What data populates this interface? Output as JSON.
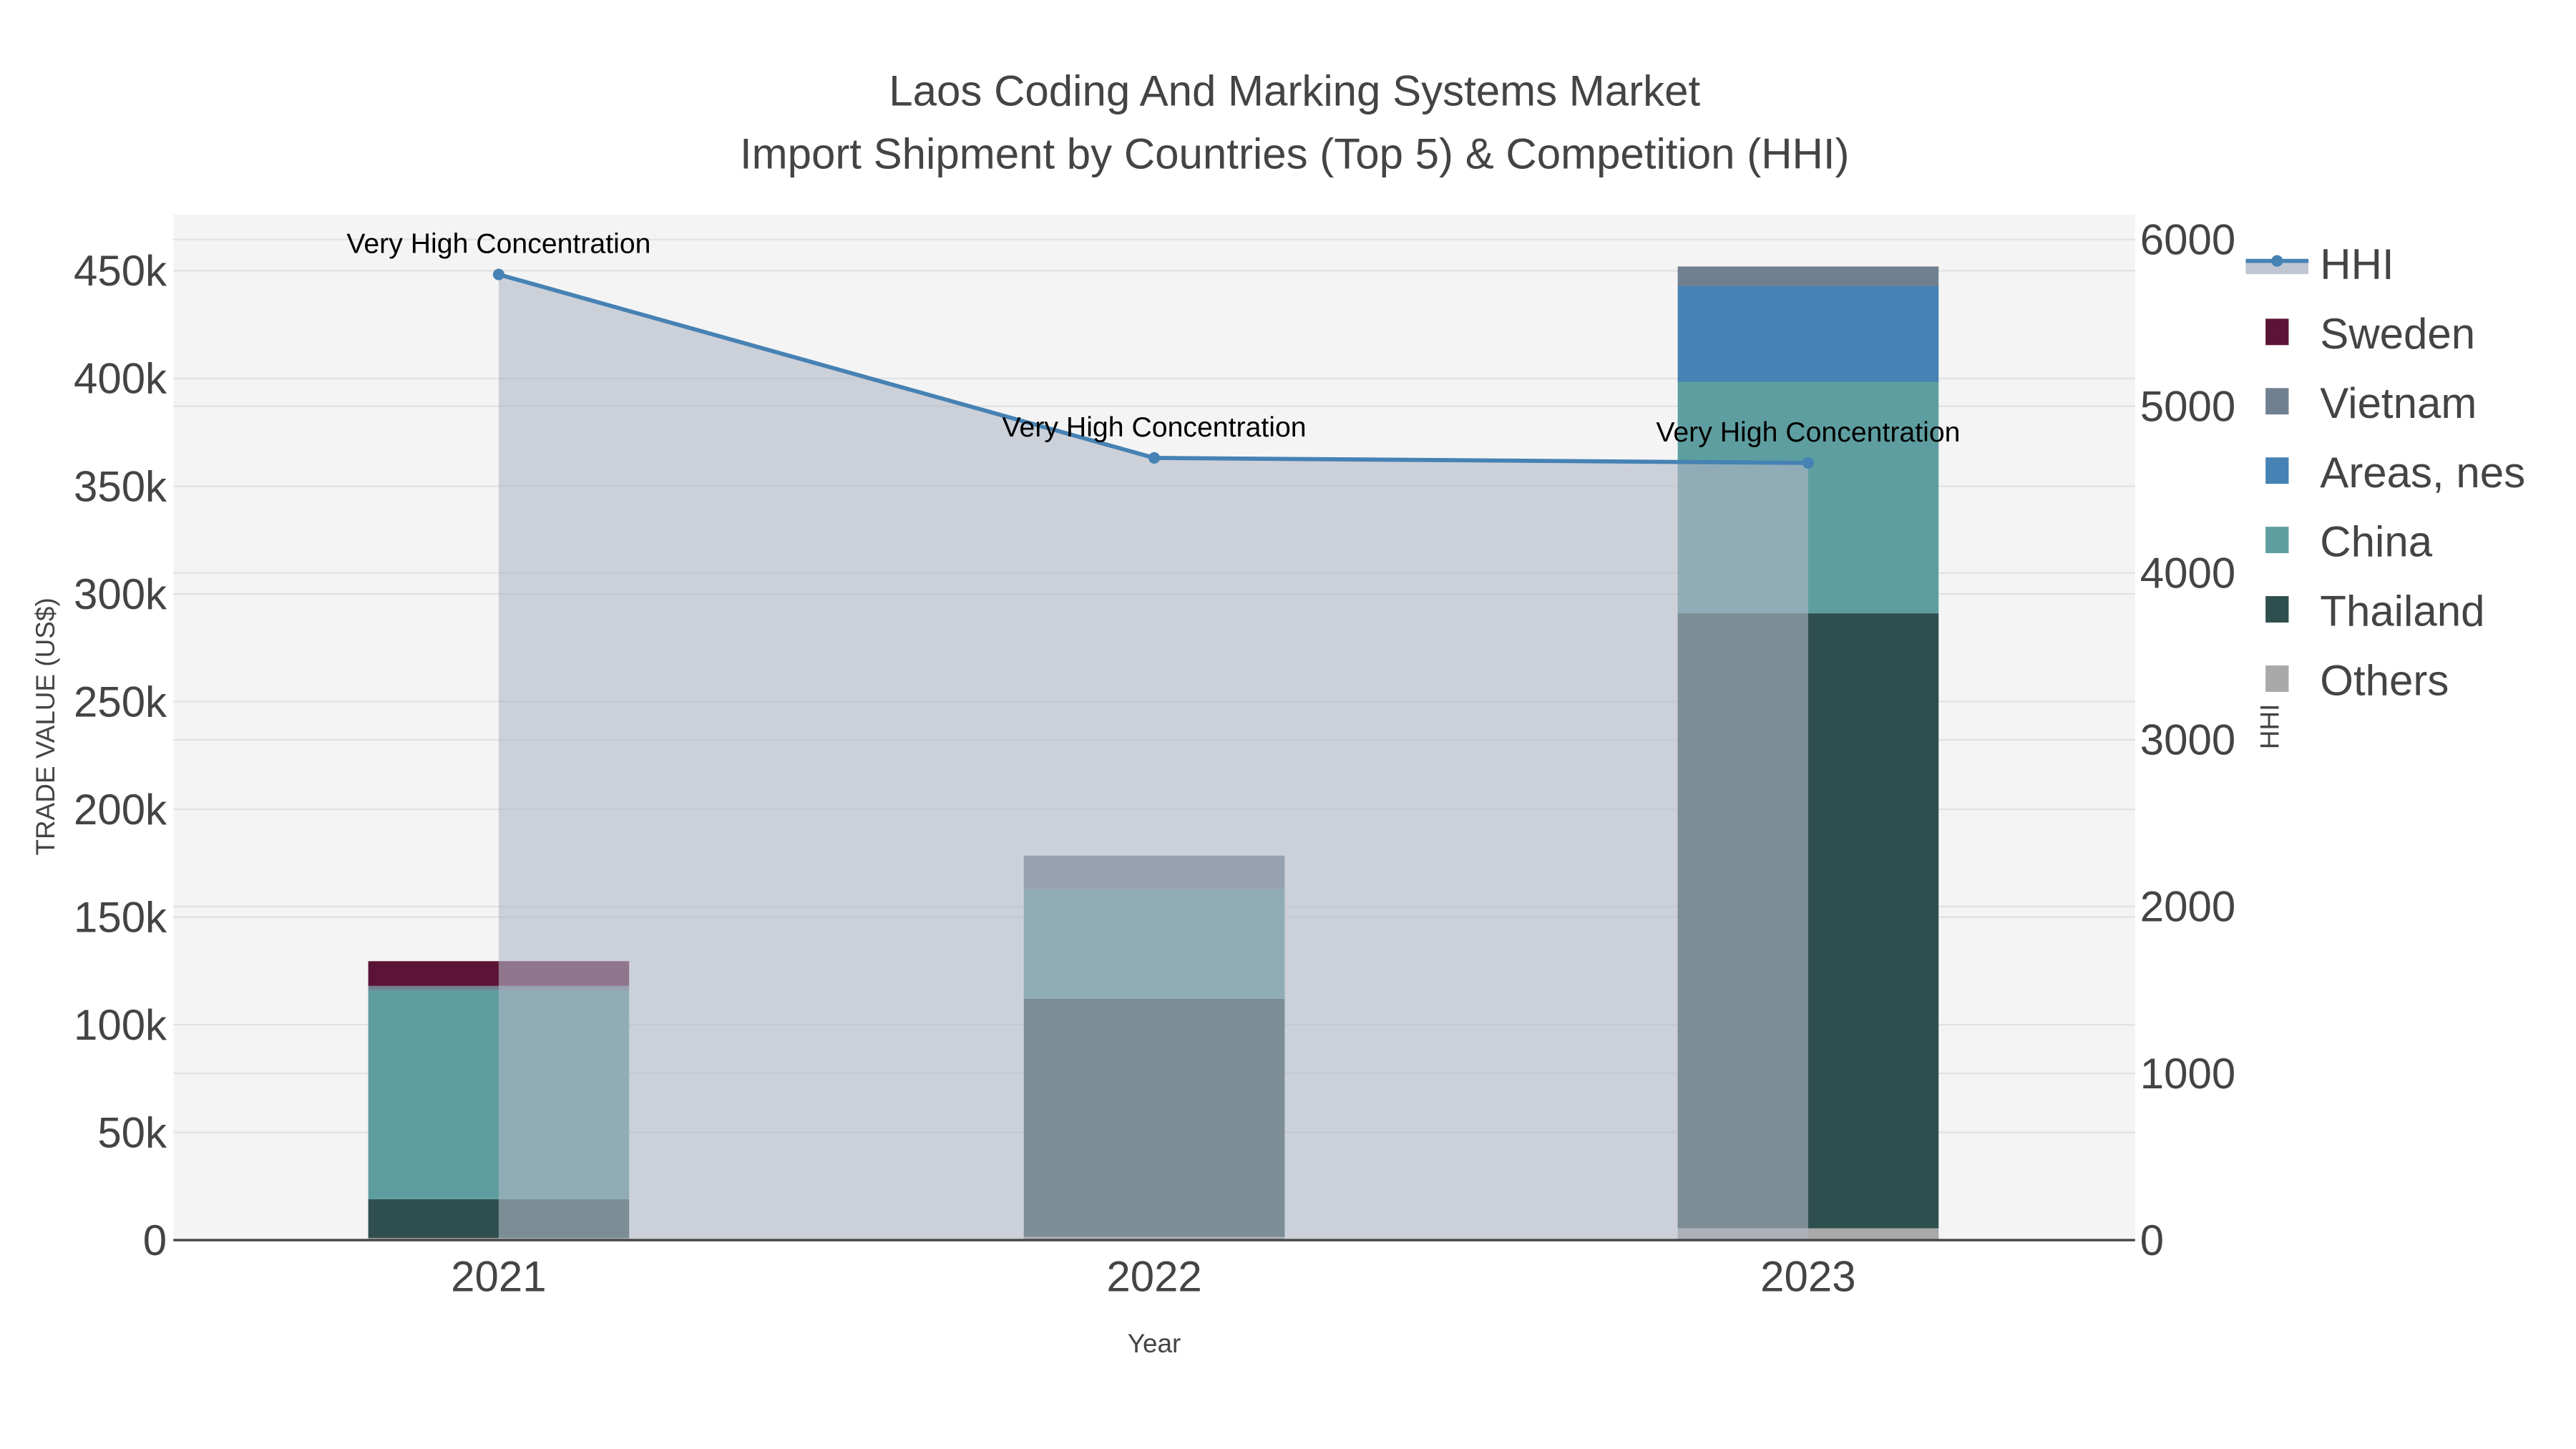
{
  "chart_data": {
    "type": "bar",
    "title": "Laos Coding And Marking Systems Market",
    "subtitle": "Import Shipment by Countries (Top 5) & Competition (HHI)",
    "xlabel": "Year",
    "ylabel": "TRADE VALUE (US$)",
    "y2label": "HHI",
    "categories": [
      "2021",
      "2022",
      "2023"
    ],
    "ylim": [
      0,
      475000
    ],
    "y2lim": [
      0,
      6200
    ],
    "yticks": [
      0,
      50000,
      100000,
      150000,
      200000,
      250000,
      300000,
      350000,
      400000,
      450000
    ],
    "ytick_labels": [
      "0",
      "50k",
      "100k",
      "150k",
      "200k",
      "250k",
      "300k",
      "350k",
      "400k",
      "450k"
    ],
    "y2ticks": [
      0,
      1000,
      2000,
      3000,
      4000,
      5000,
      6000
    ],
    "y2tick_labels": [
      "0",
      "1000",
      "2000",
      "3000",
      "4000",
      "5000",
      "6000"
    ],
    "stack_order": [
      "Others",
      "Thailand",
      "China",
      "Areas, nes",
      "Vietnam",
      "Sweden"
    ],
    "series": [
      {
        "name": "Sweden",
        "color": "#5c1436",
        "values": [
          11500,
          0,
          0
        ]
      },
      {
        "name": "Vietnam",
        "color": "#708090",
        "values": [
          2000,
          15500,
          9000
        ]
      },
      {
        "name": "Areas, nes",
        "color": "#4682b4",
        "values": [
          0,
          0,
          44500
        ]
      },
      {
        "name": "China",
        "color": "#5f9ea0",
        "values": [
          97000,
          51000,
          107500
        ]
      },
      {
        "name": "Thailand",
        "color": "#2f4f4f",
        "values": [
          18000,
          110500,
          285500
        ]
      },
      {
        "name": "Others",
        "color": "#a9a9a9",
        "values": [
          1000,
          1500,
          5500
        ]
      }
    ],
    "hhi": {
      "name": "HHI",
      "color": "#4682b4",
      "values": [
        5790,
        4690,
        4660
      ],
      "annotations": [
        "Very High Concentration",
        "Very High Concentration",
        "Very High Concentration"
      ]
    },
    "legend": [
      "HHI",
      "Sweden",
      "Vietnam",
      "Areas, nes",
      "China",
      "Thailand",
      "Others"
    ],
    "legend_position": "right",
    "grid": true
  }
}
